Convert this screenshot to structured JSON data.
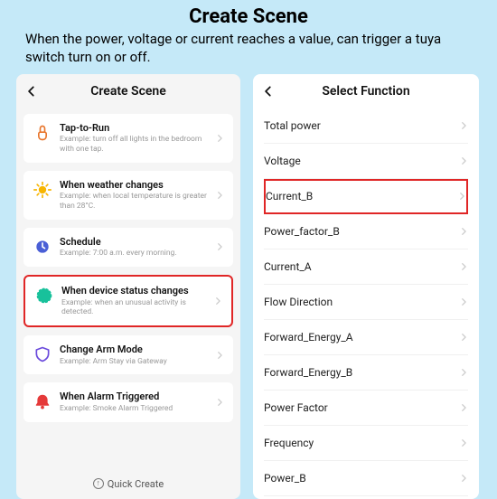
{
  "page_title": "Create Scene",
  "subtitle": "When the power, voltage or current reaches a value, can trigger a tuya switch turn on or off.",
  "left": {
    "nav_title": "Create Scene",
    "quick_label": "Quick Create",
    "cards": [
      {
        "title": "Tap-to-Run",
        "sub": "Example: turn off all lights in the bedroom with one tap.",
        "icon": "tap",
        "highlight": false
      },
      {
        "title": "When weather changes",
        "sub": "Example: when local temperature is greater than 28°C.",
        "icon": "sun",
        "highlight": false
      },
      {
        "title": "Schedule",
        "sub": "Example: 7:00 a.m. every morning.",
        "icon": "clock",
        "highlight": false
      },
      {
        "title": "When device status changes",
        "sub": "Example: when an unusual activity is detected.",
        "icon": "device",
        "highlight": true
      },
      {
        "title": "Change Arm Mode",
        "sub": "Example: Arm Stay via Gateway",
        "icon": "shield",
        "highlight": false
      },
      {
        "title": "When Alarm Triggered",
        "sub": "Example: Smoke Alarm Triggered",
        "icon": "alarm",
        "highlight": false
      }
    ]
  },
  "right": {
    "nav_title": "Select Function",
    "rows": [
      {
        "label": "Total power",
        "highlight": false
      },
      {
        "label": "Voltage",
        "highlight": false
      },
      {
        "label": "Current_B",
        "highlight": true
      },
      {
        "label": "Power_factor_B",
        "highlight": false
      },
      {
        "label": "Current_A",
        "highlight": false
      },
      {
        "label": "Flow Direction",
        "highlight": false
      },
      {
        "label": "Forward_Energy_A",
        "highlight": false
      },
      {
        "label": "Forward_Energy_B",
        "highlight": false
      },
      {
        "label": "Power Factor",
        "highlight": false
      },
      {
        "label": "Frequency",
        "highlight": false
      },
      {
        "label": "Power_B",
        "highlight": false
      }
    ]
  }
}
